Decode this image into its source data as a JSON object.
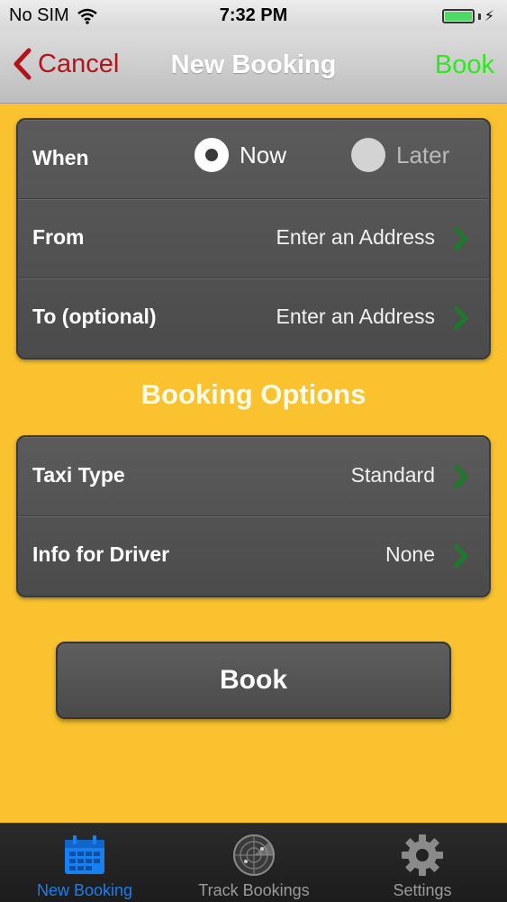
{
  "status_bar": {
    "carrier": "No SIM",
    "time": "7:32 PM"
  },
  "nav": {
    "cancel": "Cancel",
    "title": "New Booking",
    "book": "Book"
  },
  "trip": {
    "when": {
      "label": "When",
      "options": [
        "Now",
        "Later"
      ],
      "selected": "Now"
    },
    "from": {
      "label": "From",
      "value": "Enter an Address"
    },
    "to": {
      "label": "To (optional)",
      "value": "Enter an Address"
    }
  },
  "options_title": "Booking Options",
  "options": {
    "taxi_type": {
      "label": "Taxi Type",
      "value": "Standard"
    },
    "driver_info": {
      "label": "Info for Driver",
      "value": "None"
    }
  },
  "book_button": "Book",
  "tabs": [
    {
      "label": "New Booking",
      "icon": "calendar-icon",
      "active": true
    },
    {
      "label": "Track Bookings",
      "icon": "radar-icon",
      "active": false
    },
    {
      "label": "Settings",
      "icon": "gear-icon",
      "active": false
    }
  ],
  "colors": {
    "background": "#f9c22e",
    "cancel": "#b2141b",
    "book": "#2ee81f",
    "active_tab": "#1a7ff0",
    "chevron": "#1e7a2a"
  }
}
